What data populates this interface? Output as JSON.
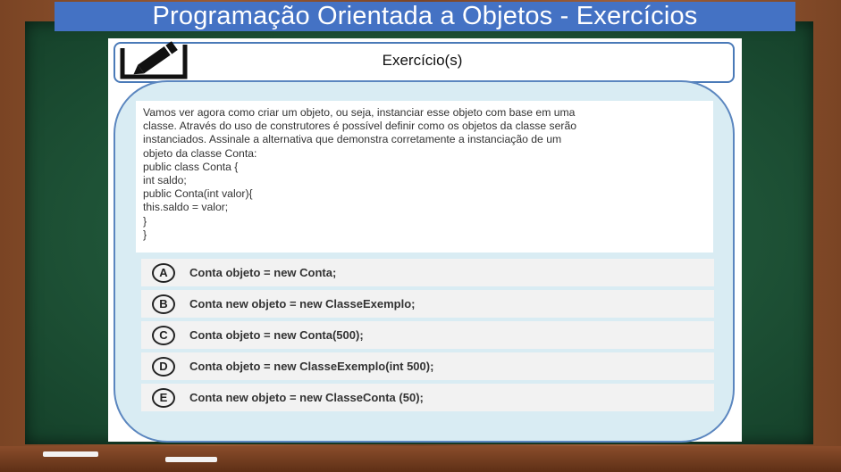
{
  "slide": {
    "title": "Programação Orientada a Objetos - Exercícios"
  },
  "exercise": {
    "header_label": "Exercício(s)",
    "question_lines": [
      "Vamos ver agora como criar um objeto, ou seja, instanciar esse objeto com base em uma",
      "classe. Através do uso de construtores é possível definir como os objetos da classe serão",
      "instanciados. Assinale a alternativa que demonstra corretamente a instanciação de um",
      "objeto da classe Conta:",
      "public class Conta {",
      "int saldo;",
      "public Conta(int valor){",
      "this.saldo = valor;",
      "}",
      "}"
    ],
    "options": [
      {
        "letter": "A",
        "text": "Conta objeto = new Conta;"
      },
      {
        "letter": "B",
        "text": "Conta new objeto = new ClasseExemplo;"
      },
      {
        "letter": "C",
        "text": "Conta objeto = new Conta(500);"
      },
      {
        "letter": "D",
        "text": " Conta objeto = new ClasseExemplo(int 500);"
      },
      {
        "letter": "E",
        "text": "Conta new objeto = new ClasseConta (50);"
      }
    ]
  },
  "icons": {
    "header": "pencil-icon"
  },
  "colors": {
    "title_bar": "#4472c4",
    "chalkboard": "#1e5236",
    "card_fill": "#d9ecf3",
    "card_border": "#5b86bf",
    "frame": "#8a4d2b"
  }
}
